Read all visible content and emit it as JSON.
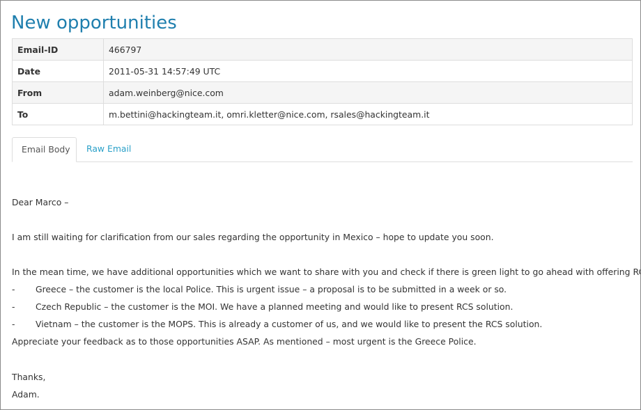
{
  "page": {
    "title": "New opportunities"
  },
  "meta": [
    {
      "key": "Email-ID",
      "value": "466797"
    },
    {
      "key": "Date",
      "value": "2011-05-31 14:57:49 UTC"
    },
    {
      "key": "From",
      "value": "adam.weinberg@nice.com"
    },
    {
      "key": "To",
      "value": "m.bettini@hackingteam.it, omri.kletter@nice.com, rsales@hackingteam.it"
    }
  ],
  "tabs": [
    {
      "label": "Email Body",
      "active": true
    },
    {
      "label": "Raw Email",
      "active": false
    }
  ],
  "body": {
    "greeting": "Dear Marco –",
    "para1": "I am still waiting for clarification from our sales regarding the opportunity in Mexico – hope to update you soon.",
    "para2": "In the mean time, we have additional opportunities which we want to share with you and check if there is green light to go ahead with offering RCS.",
    "bullet_marker": "-",
    "bullets": [
      "Greece – the customer is the local Police. This is urgent issue – a proposal is to be submitted in a week or so.",
      "Czech Republic – the customer is the MOI. We have a planned meeting and would like to present RCS solution.",
      "Vietnam – the customer is the MOPS. This is already a customer of us, and we would like to present the RCS solution."
    ],
    "closing_para": "Appreciate your feedback as to those opportunities ASAP. As mentioned – most urgent is the Greece Police.",
    "signoff": "Thanks,",
    "signature": "Adam."
  },
  "colors": {
    "title": "#1f7fae",
    "link": "#2aa0c8",
    "border": "#dddddd",
    "row_stripe": "#f5f5f5",
    "text": "#333333"
  }
}
